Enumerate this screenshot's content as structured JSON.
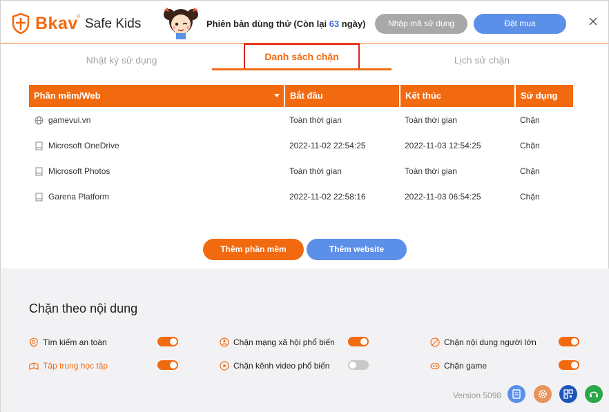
{
  "header": {
    "brand": "Bkav",
    "brand_tm": "®",
    "product": "Safe Kids",
    "trial_prefix": "Phiên bản dùng thử (Còn lại ",
    "trial_days": "63",
    "trial_suffix": " ngày)",
    "enter_code_label": "Nhập mã sử dụng",
    "buy_label": "Đặt mua",
    "close_icon": "close-icon"
  },
  "tabs": [
    {
      "label": "Nhật ký sử dụng",
      "active": false
    },
    {
      "label": "Danh sách chặn",
      "active": true
    },
    {
      "label": "Lịch sử chặn",
      "active": false
    }
  ],
  "table": {
    "columns": [
      "Phần mềm/Web",
      "Bắt đầu",
      "Kết thúc",
      "Sử dụng"
    ],
    "rows": [
      {
        "icon": "globe-icon",
        "name": "gamevui.vn",
        "start": "Toàn thời gian",
        "end": "Toàn thời gian",
        "use": "Chặn"
      },
      {
        "icon": "app-icon",
        "name": "Microsoft OneDrive",
        "start": "2022-11-02 22:54:25",
        "end": "2022-11-03 12:54:25",
        "use": "Chặn"
      },
      {
        "icon": "app-icon",
        "name": "Microsoft Photos",
        "start": "Toàn thời gian",
        "end": "Toàn thời gian",
        "use": "Chặn"
      },
      {
        "icon": "app-icon",
        "name": "Garena Platform",
        "start": "2022-11-02 22:58:16",
        "end": "2022-11-03 06:54:25",
        "use": "Chặn"
      }
    ]
  },
  "actions": {
    "add_app_label": "Thêm phần mềm",
    "add_web_label": "Thêm website"
  },
  "content_block": {
    "title": "Chặn theo nội dung",
    "options": [
      {
        "label": "Tìm kiếm an toàn",
        "icon": "safe-search-icon",
        "enabled": true
      },
      {
        "label": "Chặn mạng xã hội phổ biến",
        "icon": "social-network-icon",
        "enabled": true
      },
      {
        "label": "Chặn nội dung người lớn",
        "icon": "adult-content-icon",
        "enabled": true
      },
      {
        "label": "Tập trung học tập",
        "icon": "study-icon",
        "enabled": true
      },
      {
        "label": "Chặn kênh video phổ biến",
        "icon": "video-channel-icon",
        "enabled": false
      },
      {
        "label": "Chặn game",
        "icon": "game-icon",
        "enabled": true
      }
    ]
  },
  "footer": {
    "version": "Version 5098",
    "buttons": [
      "report-icon",
      "settings-icon",
      "qr-code-icon",
      "support-headset-icon"
    ]
  },
  "colors": {
    "accent": "#f26a10",
    "blue": "#5b8fe8",
    "gray_button": "#a8a8a8",
    "active_tab_highlight": "#e02020"
  }
}
